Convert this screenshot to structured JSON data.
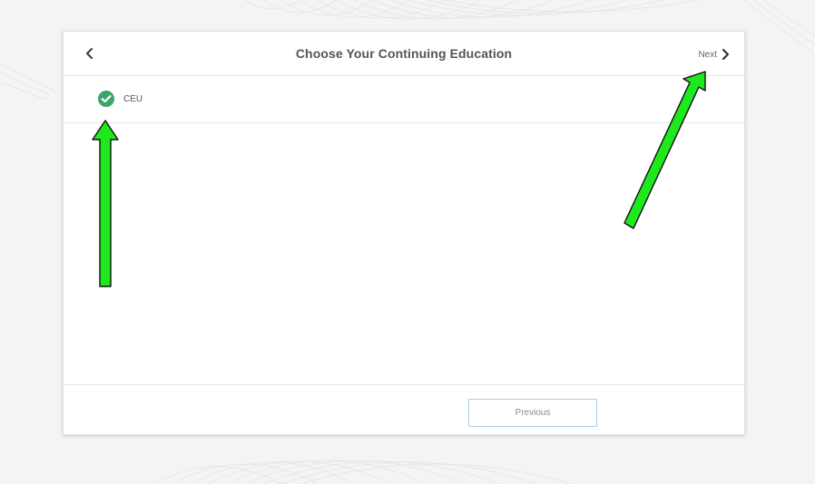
{
  "header": {
    "title": "Choose Your Continuing Education",
    "back_icon": "chevron-left-icon",
    "next_label": "Next",
    "next_icon": "chevron-right-icon"
  },
  "options": [
    {
      "label": "CEU",
      "selected": true,
      "icon": "check-circle-icon"
    }
  ],
  "footer": {
    "previous_label": "Previous"
  },
  "colors": {
    "check_green": "#3aa566",
    "arrow_green": "#1ee81e",
    "previous_border": "#a9cde5",
    "title_text": "#555555"
  }
}
